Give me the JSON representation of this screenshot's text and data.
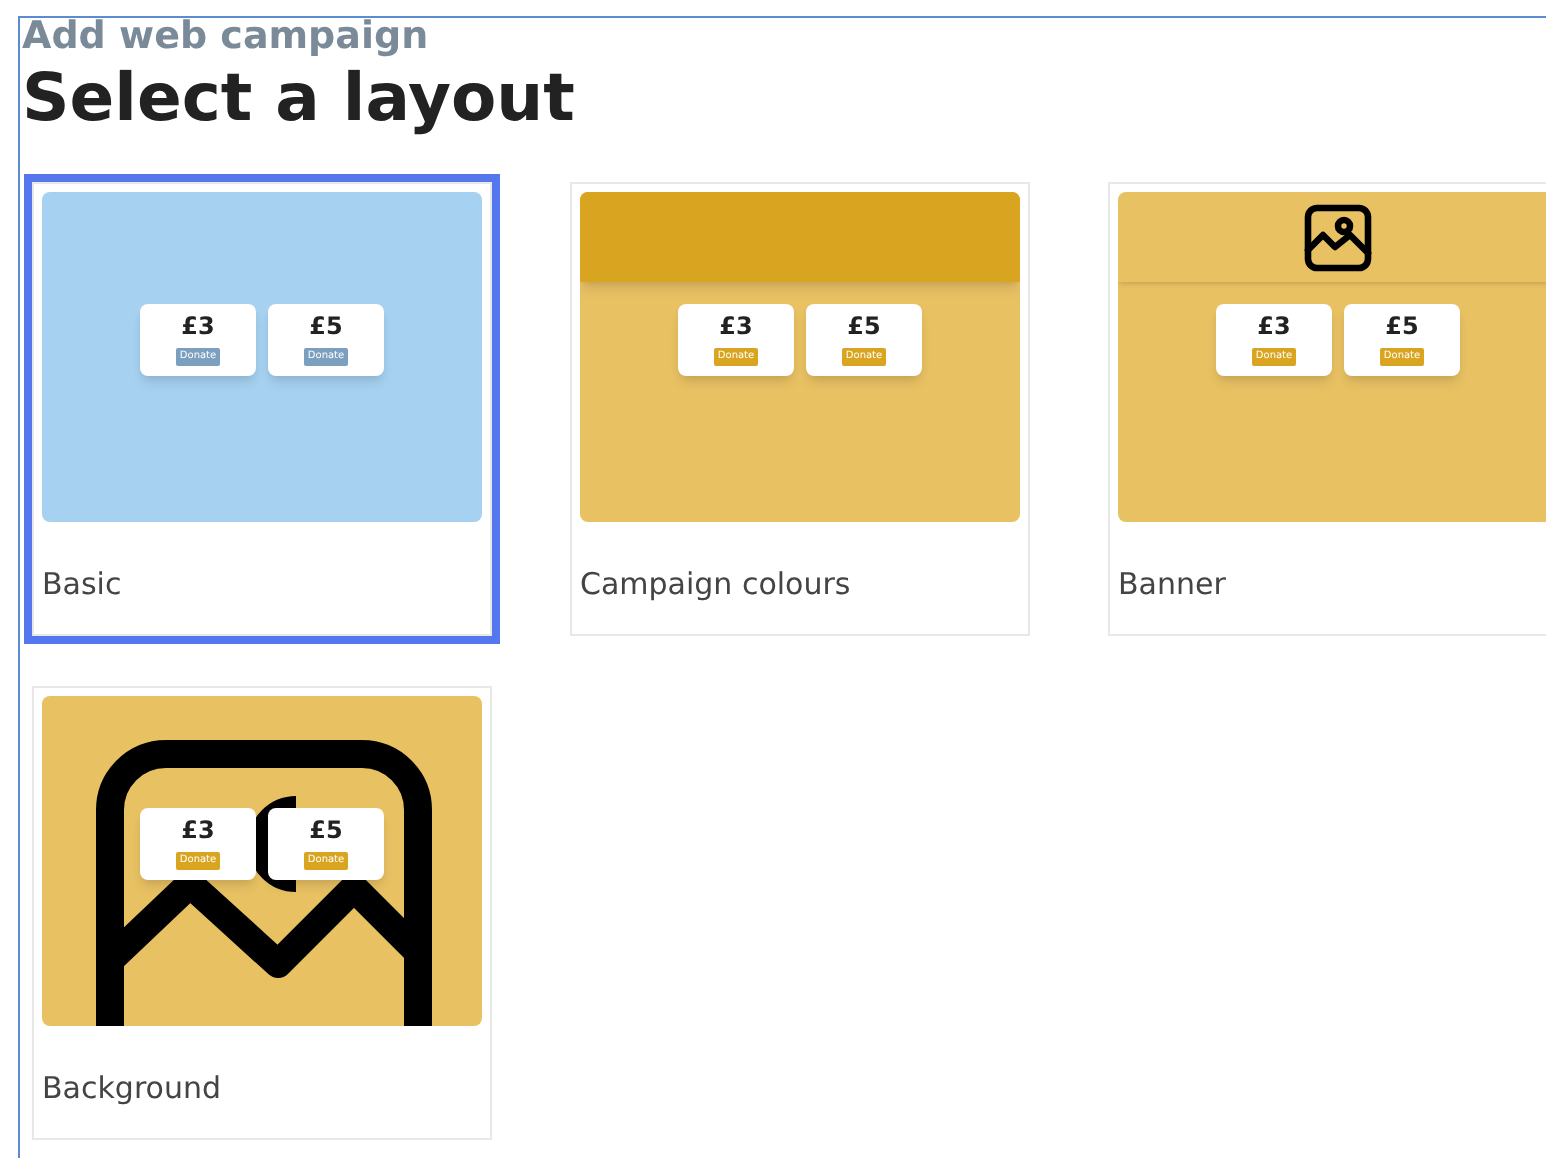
{
  "header": {
    "subtitle": "Add web campaign",
    "title": "Select a layout"
  },
  "layouts": [
    {
      "label": "Basic",
      "kind": "basic",
      "selected": true,
      "amounts": [
        {
          "price": "£3",
          "button": "Donate"
        },
        {
          "price": "£5",
          "button": "Donate"
        }
      ]
    },
    {
      "label": "Campaign colours",
      "kind": "colours",
      "selected": false,
      "amounts": [
        {
          "price": "£3",
          "button": "Donate"
        },
        {
          "price": "£5",
          "button": "Donate"
        }
      ]
    },
    {
      "label": "Banner",
      "kind": "banner",
      "selected": false,
      "amounts": [
        {
          "price": "£3",
          "button": "Donate"
        },
        {
          "price": "£5",
          "button": "Donate"
        }
      ]
    },
    {
      "label": "Background",
      "kind": "background",
      "selected": false,
      "amounts": [
        {
          "price": "£3",
          "button": "Donate"
        },
        {
          "price": "£5",
          "button": "Donate"
        }
      ]
    }
  ]
}
